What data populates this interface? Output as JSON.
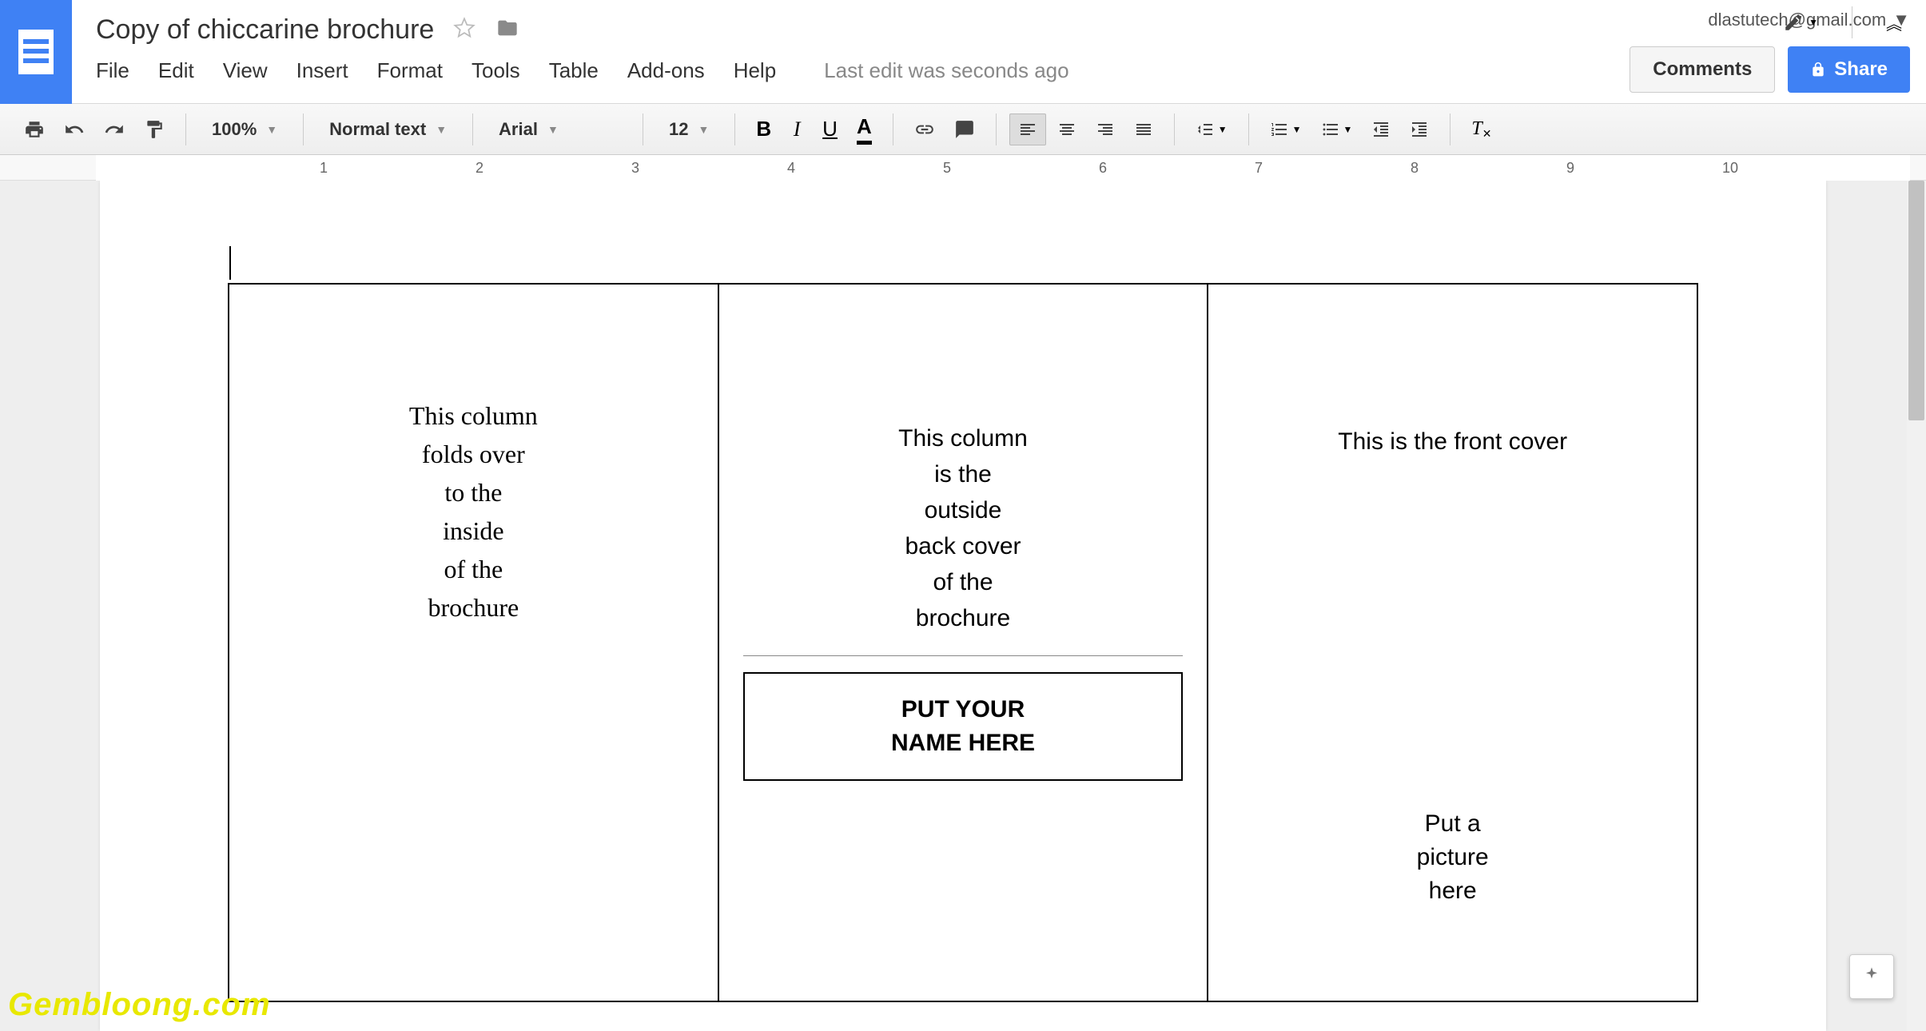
{
  "header": {
    "doc_title": "Copy of chiccarine brochure",
    "user_email": "dlastutech@gmail.com",
    "comments_label": "Comments",
    "share_label": "Share"
  },
  "menu": {
    "items": [
      "File",
      "Edit",
      "View",
      "Insert",
      "Format",
      "Tools",
      "Table",
      "Add-ons",
      "Help"
    ],
    "edit_status": "Last edit was seconds ago"
  },
  "toolbar": {
    "zoom": "100%",
    "style": "Normal text",
    "font": "Arial",
    "font_size": "12"
  },
  "ruler": {
    "ticks": [
      "1",
      "2",
      "3",
      "4",
      "5",
      "6",
      "7",
      "8",
      "9",
      "10"
    ]
  },
  "document": {
    "col1": "This column\nfolds over\nto the\ninside\nof the\nbrochure",
    "col2": "This column\nis the\noutside\nback cover\nof the\nbrochure",
    "col2_name_box": "PUT YOUR\nNAME HERE",
    "col3_title": "This is the front cover",
    "col3_pic": "Put a\npicture\nhere"
  },
  "watermark": "Gembloong.com"
}
